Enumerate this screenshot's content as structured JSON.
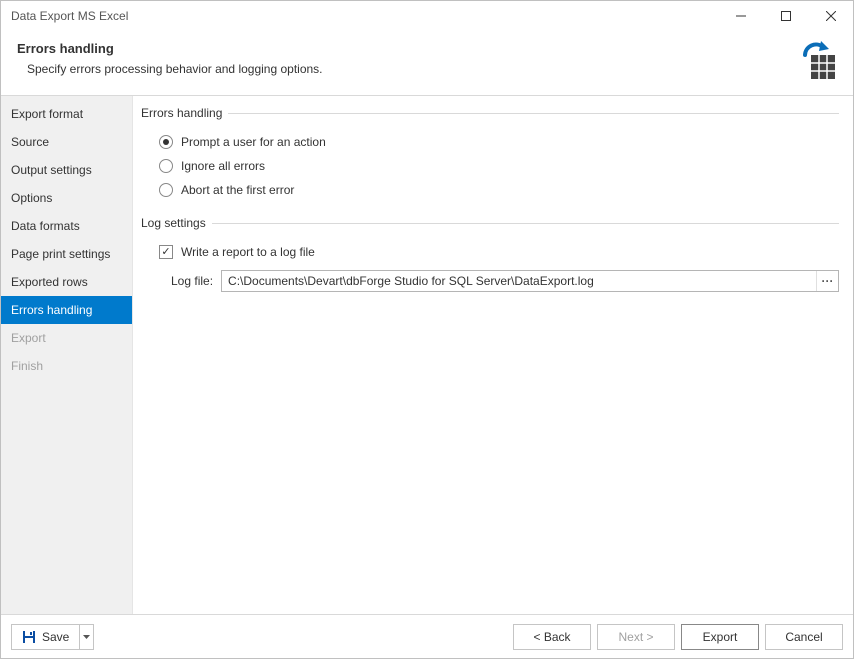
{
  "window": {
    "title": "Data Export MS Excel"
  },
  "header": {
    "title": "Errors handling",
    "subtitle": "Specify errors processing behavior and logging options."
  },
  "sidebar": {
    "items": [
      {
        "label": "Export format"
      },
      {
        "label": "Source"
      },
      {
        "label": "Output settings"
      },
      {
        "label": "Options"
      },
      {
        "label": "Data formats"
      },
      {
        "label": "Page print settings"
      },
      {
        "label": "Exported rows"
      },
      {
        "label": "Errors handling"
      },
      {
        "label": "Export"
      },
      {
        "label": "Finish"
      }
    ]
  },
  "errors_group": {
    "legend": "Errors handling",
    "options": {
      "prompt": "Prompt a user for an action",
      "ignore": "Ignore all errors",
      "abort": "Abort at the first error"
    }
  },
  "log_group": {
    "legend": "Log settings",
    "write_report": "Write a report to a log file",
    "logfile_label": "Log file:",
    "logfile_value": "C:\\Documents\\Devart\\dbForge Studio for SQL Server\\DataExport.log",
    "browse": "···"
  },
  "footer": {
    "save": "Save",
    "back": "< Back",
    "next": "Next >",
    "export": "Export",
    "cancel": "Cancel"
  }
}
